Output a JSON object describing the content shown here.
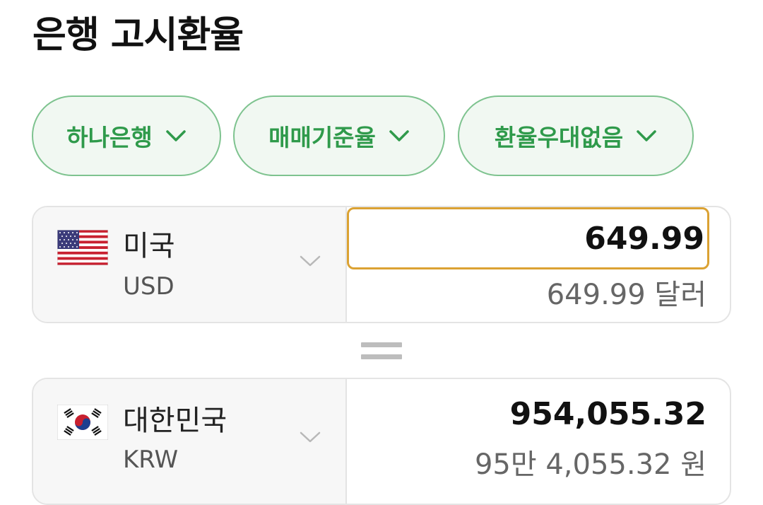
{
  "page": {
    "title": "은행 고시환율"
  },
  "filters": {
    "bank": "하나은행",
    "rate_type": "매매기준율",
    "preference": "환율우대없음"
  },
  "from": {
    "flag": "us-flag-icon",
    "country": "미국",
    "code": "USD",
    "amount_value": "649.99",
    "amount_text": "649.99 달러"
  },
  "to": {
    "flag": "kr-flag-icon",
    "country": "대한민국",
    "code": "KRW",
    "amount_value": "954,055.32",
    "amount_text": "95만 4,055.32 원"
  },
  "colors": {
    "accent_green": "#2f9a4b",
    "chip_border": "#7ec38f",
    "input_focus": "#dba233"
  }
}
